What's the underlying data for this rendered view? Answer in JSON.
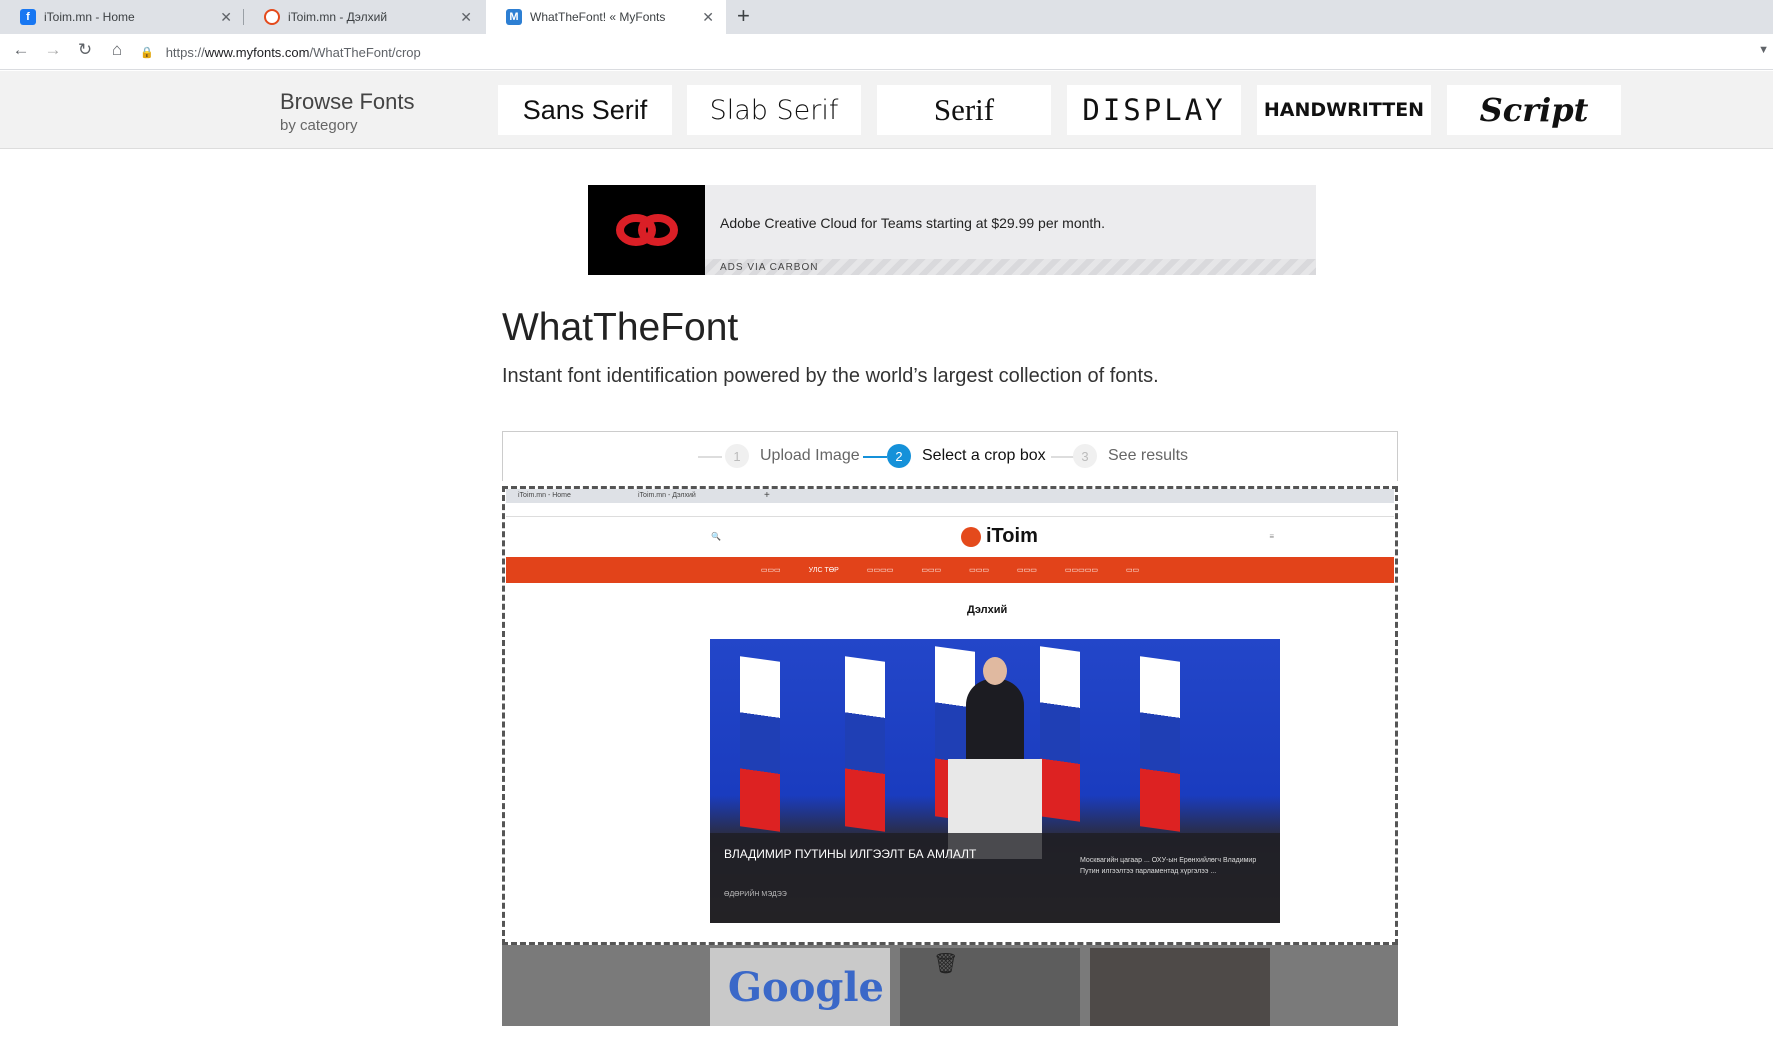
{
  "browser": {
    "tabs": [
      {
        "title": "iToim.mn - Home",
        "icon": "facebook-icon",
        "color": "#1877f2",
        "glyph": "f"
      },
      {
        "title": "iToim.mn - Дэлхий",
        "icon": "itoim-icon",
        "color": "#e44a1c",
        "glyph": ""
      },
      {
        "title": "WhatTheFont! « MyFonts",
        "icon": "myfonts-icon",
        "color": "#2d7fd3",
        "glyph": "M"
      }
    ],
    "url_prefix": "https://",
    "url_host": "www.myfonts.com",
    "url_path": "/WhatTheFont/crop"
  },
  "categories": {
    "heading": "Browse Fonts",
    "subheading": "by category",
    "items": [
      "Sans Serif",
      "Slab Serif",
      "Serif",
      "DISPLAY",
      "HANDWRITTEN",
      "Script"
    ]
  },
  "ad": {
    "text": "Adobe Creative Cloud for Teams starting at $29.99 per month.",
    "via": "ADS VIA CARBON"
  },
  "page": {
    "title": "WhatTheFont",
    "subtitle": "Instant font identification powered by the world’s largest collection of fonts."
  },
  "steps": [
    {
      "num": "1",
      "label": "Upload Image"
    },
    {
      "num": "2",
      "label": "Select a crop box"
    },
    {
      "num": "3",
      "label": "See results"
    }
  ],
  "preview": {
    "tab1": "iToim.mn - Home",
    "tab2": "iToim.mn - Дэлхий",
    "site_name": "iToim",
    "section": "Дэлхий",
    "nav_item": "УЛС ТӨР",
    "headline": "ВЛАДИМИР ПУТИНЫ ИЛГЭЭЛТ БА АМЛАЛТ",
    "byline": "ӨДӨРИЙН МЭДЭЭ",
    "side_text": "Москвагийн цагаар ... ОХУ-ын Ерөнхийлөгч Владимир Путин илгээлтээ парламентад хүргэлээ ...",
    "thumb_text": "Google"
  }
}
